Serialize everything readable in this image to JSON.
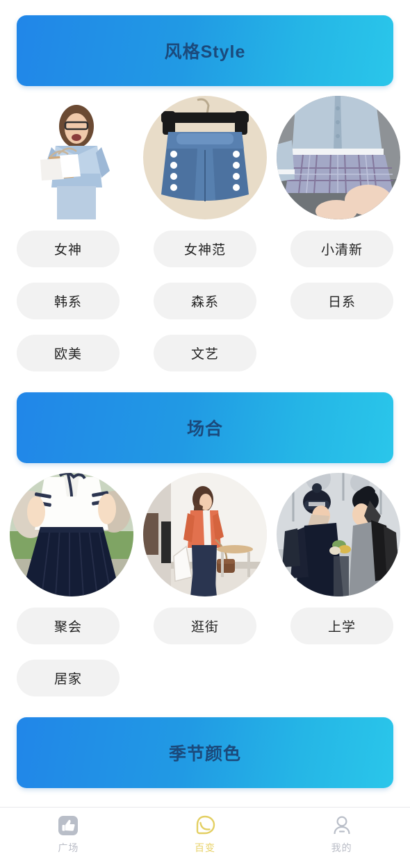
{
  "app": {
    "background_color": "#ffffff",
    "banner_gradient_start": "#2186e8",
    "banner_gradient_end": "#2ac6ea",
    "banner_text_color": "#1b4a7c",
    "tag_background": "#f2f2f2",
    "tag_text_color": "#222222",
    "tab_inactive_color": "#b9bcc6",
    "tab_active_color": "#e8d26a"
  },
  "sections": [
    {
      "title": "风格Style",
      "images": [
        {
          "name": "woman-denim-jacket-shopping-bags",
          "shape": "plain"
        },
        {
          "name": "denim-shorts-on-hanger",
          "shape": "circle"
        },
        {
          "name": "plaid-pleated-skirt-outfit",
          "shape": "circle"
        }
      ],
      "tags": [
        "女神",
        "女神范",
        "小清新",
        "韩系",
        "森系",
        "日系",
        "欧美",
        "文艺"
      ]
    },
    {
      "title": "场合",
      "images": [
        {
          "name": "sailor-top-navy-pleated-skirt",
          "shape": "circle"
        },
        {
          "name": "woman-coral-cardigan-street",
          "shape": "circle"
        },
        {
          "name": "two-women-winter-coats-beanies",
          "shape": "circle"
        }
      ],
      "tags": [
        "聚会",
        "逛街",
        "上学",
        "居家"
      ]
    },
    {
      "title": "季节颜色",
      "images": [],
      "tags": []
    }
  ],
  "tabbar": {
    "items": [
      {
        "label": "广场",
        "icon": "thumbs-up-icon",
        "active": false
      },
      {
        "label": "百变",
        "icon": "chat-bubble-icon",
        "active": true
      },
      {
        "label": "我的",
        "icon": "person-icon",
        "active": false
      }
    ]
  }
}
